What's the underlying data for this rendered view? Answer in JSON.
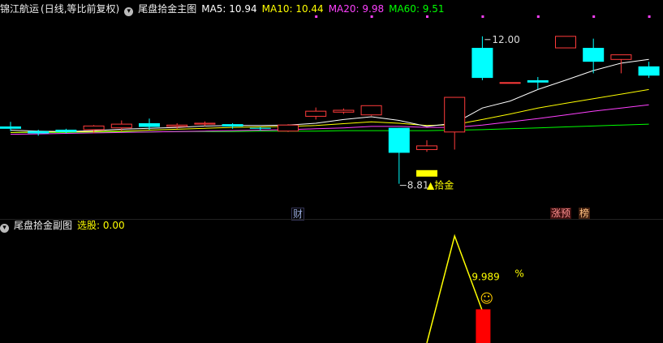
{
  "header": {
    "stock": "锦江航运",
    "period": "(日线,等比前复权)",
    "indicator": "尾盘拾金主图",
    "ma": [
      {
        "label": "MA5: 10.94",
        "color": "#ffffff"
      },
      {
        "label": "MA10: 10.44",
        "color": "#ffff00"
      },
      {
        "label": "MA20: 9.98",
        "color": "#ff40ff"
      },
      {
        "label": "MA60: 9.51",
        "color": "#00ff00"
      }
    ]
  },
  "sub_header": {
    "indicator": "尾盘拾金副图",
    "pick": "选股: 0.00"
  },
  "colors": {
    "up": "#ff3b3b",
    "down": "#00ffff",
    "ma5": "#ffffff",
    "ma10": "#ffff00",
    "ma20": "#ff40ff",
    "ma60": "#00ff00",
    "signal": "#ffff00",
    "bar": "#ff0000"
  },
  "chart_data": [
    {
      "type": "candlestick",
      "price_range": [
        8.4,
        12.4
      ],
      "candles": [
        {
          "o": 10.05,
          "c": 10.0,
          "h": 10.15,
          "l": 9.95
        },
        {
          "o": 9.95,
          "c": 9.9,
          "h": 9.98,
          "l": 9.85
        },
        {
          "o": 9.98,
          "c": 9.93,
          "h": 10.0,
          "l": 9.9
        },
        {
          "o": 9.98,
          "c": 10.06,
          "h": 10.08,
          "l": 9.9
        },
        {
          "o": 10.02,
          "c": 10.1,
          "h": 10.18,
          "l": 9.95
        },
        {
          "o": 10.12,
          "c": 10.04,
          "h": 10.22,
          "l": 9.98
        },
        {
          "o": 10.05,
          "c": 10.08,
          "h": 10.12,
          "l": 10.0
        },
        {
          "o": 10.1,
          "c": 10.12,
          "h": 10.16,
          "l": 10.06
        },
        {
          "o": 10.1,
          "c": 10.05,
          "h": 10.12,
          "l": 10.0
        },
        {
          "o": 10.02,
          "c": 10.0,
          "h": 10.04,
          "l": 9.96
        },
        {
          "o": 9.95,
          "c": 10.08,
          "h": 10.1,
          "l": 9.93
        },
        {
          "o": 10.27,
          "c": 10.38,
          "h": 10.46,
          "l": 10.2
        },
        {
          "o": 10.36,
          "c": 10.4,
          "h": 10.44,
          "l": 10.32
        },
        {
          "o": 10.3,
          "c": 10.5,
          "h": 10.5,
          "l": 10.28
        },
        {
          "o": 10.02,
          "c": 9.48,
          "h": 10.02,
          "l": 8.81
        },
        {
          "o": 9.55,
          "c": 9.63,
          "h": 9.75,
          "l": 9.5
        },
        {
          "o": 9.93,
          "c": 10.68,
          "h": 10.68,
          "l": 9.55
        },
        {
          "o": 11.75,
          "c": 11.1,
          "h": 12.0,
          "l": 11.05
        },
        {
          "o": 11.0,
          "c": 11.0,
          "h": 11.0,
          "l": 11.0
        },
        {
          "o": 11.05,
          "c": 11.0,
          "h": 11.12,
          "l": 10.85
        },
        {
          "o": 11.75,
          "c": 12.0,
          "h": 12.0,
          "l": 11.75
        },
        {
          "o": 11.75,
          "c": 11.45,
          "h": 11.95,
          "l": 11.2
        },
        {
          "o": 11.5,
          "c": 11.6,
          "h": 11.6,
          "l": 11.2
        },
        {
          "o": 11.35,
          "c": 11.15,
          "h": 11.45,
          "l": 11.1
        }
      ],
      "ma5": [
        9.97,
        9.95,
        9.94,
        9.96,
        9.99,
        10.01,
        10.03,
        10.06,
        10.07,
        10.07,
        10.08,
        10.12,
        10.2,
        10.26,
        10.18,
        10.05,
        10.12,
        10.45,
        10.6,
        10.85,
        11.05,
        11.26,
        11.42,
        11.5
      ],
      "ma10": [
        9.92,
        9.93,
        9.93,
        9.94,
        9.95,
        9.97,
        9.99,
        10.01,
        10.03,
        10.04,
        10.05,
        10.07,
        10.11,
        10.15,
        10.12,
        10.07,
        10.09,
        10.2,
        10.32,
        10.45,
        10.55,
        10.65,
        10.75,
        10.85
      ],
      "ma20": [
        9.88,
        9.89,
        9.9,
        9.91,
        9.92,
        9.93,
        9.94,
        9.95,
        9.96,
        9.97,
        9.98,
        10.0,
        10.02,
        10.05,
        10.05,
        10.03,
        10.03,
        10.08,
        10.15,
        10.22,
        10.3,
        10.38,
        10.45,
        10.52
      ],
      "ma60": [
        9.92,
        9.92,
        9.92,
        9.93,
        9.93,
        9.93,
        9.94,
        9.94,
        9.94,
        9.95,
        9.95,
        9.95,
        9.96,
        9.96,
        9.96,
        9.96,
        9.97,
        9.98,
        10.0,
        10.02,
        10.04,
        10.06,
        10.08,
        10.1
      ],
      "annotations": {
        "high": "12.00",
        "low": "8.81",
        "buy_signal": "拾金",
        "news": "财",
        "up_limit": "涨预",
        "rank": "榜"
      }
    },
    {
      "type": "line",
      "signal_index": [
        15,
        16,
        17
      ],
      "signal_values": [
        0.0,
        1.0,
        0.3
      ],
      "bar_index": 17,
      "bar_value": 9.989,
      "bar_label": "9.989",
      "bar_unit": "%",
      "smile": "☺",
      "y_max": 12.5
    }
  ]
}
